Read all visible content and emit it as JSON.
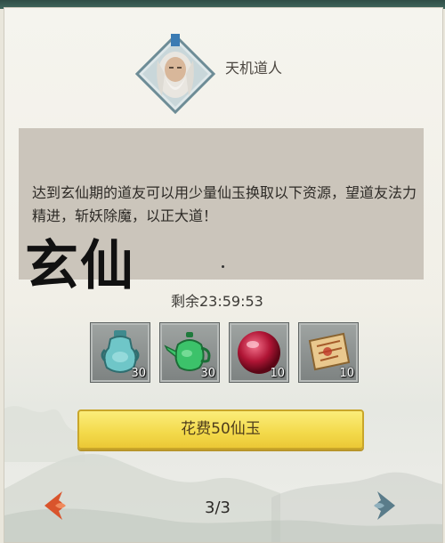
{
  "npc": {
    "name": "天机道人",
    "portrait": "old-sage-portrait"
  },
  "dialog": {
    "text": "达到玄仙期的道友可以用少量仙玉换取以下资源，望道友法力精进，斩妖除魔，以正大道！"
  },
  "overlay_title": "玄仙",
  "timer": "剩余23:59:53",
  "items": [
    {
      "icon": "blue-vase-icon",
      "qty": "30"
    },
    {
      "icon": "green-teapot-icon",
      "qty": "30"
    },
    {
      "icon": "red-orb-icon",
      "qty": "10"
    },
    {
      "icon": "scroll-icon",
      "qty": "10"
    }
  ],
  "cost_button": "花费50仙玉",
  "pagination": {
    "page": "3/3"
  },
  "colors": {
    "button_yellow": "#f3d94a",
    "arrow_left": "#d9542c",
    "arrow_right": "#5a7c8a"
  }
}
